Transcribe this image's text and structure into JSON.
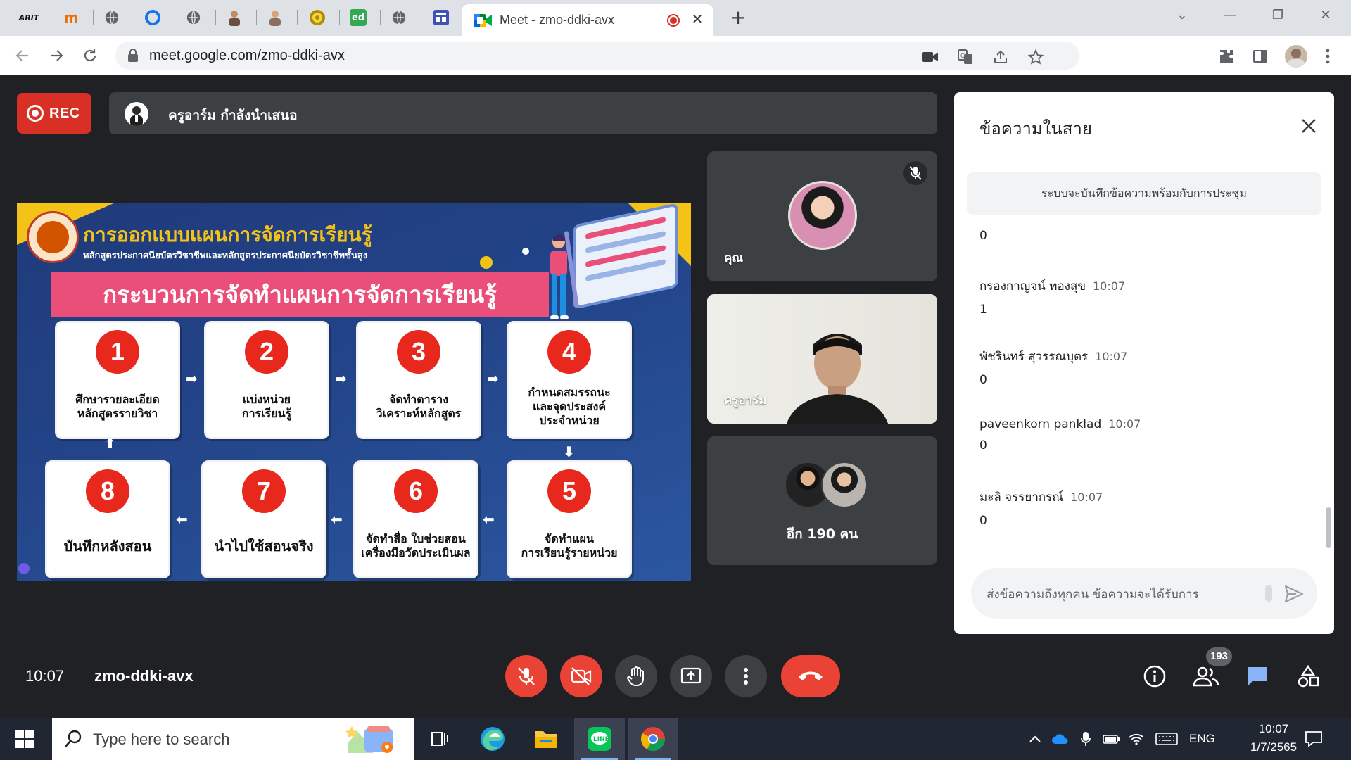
{
  "browser": {
    "active_tab_title": "Meet - zmo-ddki-avx",
    "url": "meet.google.com/zmo-ddki-avx",
    "tab_favicons": [
      {
        "label": "ARIT",
        "color": "#1a1a1a"
      },
      {
        "label": "m",
        "color": "#e8710a"
      },
      {
        "label": "",
        "color": "#5f6368"
      },
      {
        "label": "O",
        "color": "#1a73e8"
      },
      {
        "label": "",
        "color": "#5f6368"
      },
      {
        "label": "",
        "color": "#8d6e63"
      },
      {
        "label": "",
        "color": "#8d6e63"
      },
      {
        "label": "",
        "color": "#b08d00"
      },
      {
        "label": "ed",
        "color": "#34a853"
      },
      {
        "label": "",
        "color": "#5f6368"
      },
      {
        "label": "",
        "color": "#3f51b5"
      }
    ],
    "accent": "#1a73e8"
  },
  "meet": {
    "rec_label": "REC",
    "presenter_text": "ครูอาร์ม กำลังนำเสนอ",
    "time": "10:07",
    "meeting_code": "zmo-ddki-avx",
    "people_count": "193",
    "colors": {
      "danger": "#ea4335",
      "surface": "#3c4043",
      "background": "#202124"
    }
  },
  "slide": {
    "title": "การออกแบบแผนการจัดการเรียนรู้",
    "subtitle": "หลักสูตรประกาศนียบัตรวิชาชีพและหลักสูตรประกาศนียบัตรวิชาชีพชั้นสูง",
    "banner": "กระบวนการจัดทำแผนการจัดการเรียนรู้",
    "steps": [
      {
        "num": "1",
        "text": "ศึกษารายละเอียด\nหลักสูตรรายวิชา"
      },
      {
        "num": "2",
        "text": "แบ่งหน่วย\nการเรียนรู้"
      },
      {
        "num": "3",
        "text": "จัดทำตาราง\nวิเคราะห์หลักสูตร"
      },
      {
        "num": "4",
        "text": "กำหนดสมรรถนะ\nและจุดประสงค์\nประจำหน่วย"
      },
      {
        "num": "5",
        "text": "จัดทำแผน\nการเรียนรู้รายหน่วย"
      },
      {
        "num": "6",
        "text": "จัดทำสื่อ ใบช่วยสอน\nเครื่องมือวัดประเมินผล"
      },
      {
        "num": "7",
        "text": "นำไปใช้สอนจริง"
      },
      {
        "num": "8",
        "text": "บันทึกหลังสอน"
      }
    ]
  },
  "tiles": {
    "you_label": "คุณ",
    "teacher_label": "ครูอาร์ม",
    "more_label": "อีก 190 คน"
  },
  "chat": {
    "title": "ข้อความในสาย",
    "notice": "ระบบจะบันทึกข้อความพร้อมกับการประชุม",
    "first_body": "0",
    "messages": [
      {
        "sender": "กรองกาญจน์ ทองสุข",
        "time": "10:07",
        "body": "1"
      },
      {
        "sender": "พัชรินทร์ สุวรรณบุตร",
        "time": "10:07",
        "body": "0"
      },
      {
        "sender": "paveenkorn panklad",
        "time": "10:07",
        "body": "0"
      },
      {
        "sender": "มะลิ จรรยากรณ์",
        "time": "10:07",
        "body": "0"
      }
    ],
    "input_placeholder": "ส่งข้อความถึงทุกคน ข้อความจะได้รับการ"
  },
  "taskbar": {
    "search_placeholder": "Type here to search",
    "language": "ENG",
    "clock_time": "10:07",
    "clock_date": "1/7/2565"
  }
}
